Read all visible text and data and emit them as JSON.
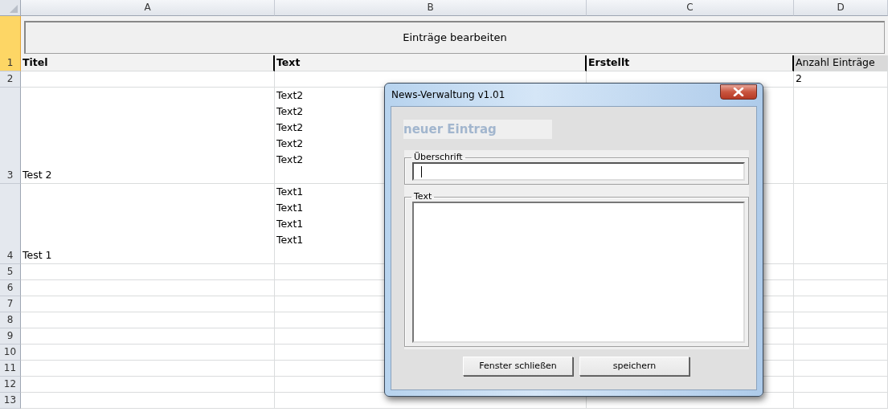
{
  "sheet": {
    "columns": [
      {
        "label": "A"
      },
      {
        "label": "B"
      },
      {
        "label": "C"
      },
      {
        "label": "D"
      }
    ],
    "sheet_button": "Einträge bearbeiten",
    "rows": [
      {
        "number": "1",
        "selected": true,
        "cells": [
          {
            "kind": "header",
            "lines": [
              "Titel"
            ]
          },
          {
            "kind": "header",
            "lines": [
              "Text"
            ]
          },
          {
            "kind": "header",
            "lines": [
              "Erstellt"
            ]
          },
          {
            "kind": "label",
            "lines": [
              "Anzahl Einträge"
            ]
          }
        ]
      },
      {
        "number": "2",
        "selected": false,
        "cells": [
          {
            "kind": "plain"
          },
          {
            "kind": "plain"
          },
          {
            "kind": "plain"
          },
          {
            "kind": "plain",
            "lines": [
              "2"
            ]
          }
        ]
      },
      {
        "number": "3",
        "selected": false,
        "cells": [
          {
            "kind": "plain",
            "lines": [
              "Test 2"
            ]
          },
          {
            "kind": "plain",
            "lines": [
              "Text2",
              "Text2",
              "Text2",
              "Text2",
              "Text2"
            ]
          },
          {
            "kind": "plain"
          },
          {
            "kind": "plain"
          }
        ]
      },
      {
        "number": "4",
        "selected": false,
        "cells": [
          {
            "kind": "plain",
            "lines": [
              "Test 1"
            ]
          },
          {
            "kind": "plain",
            "lines": [
              "Text1",
              "Text1",
              "Text1",
              "Text1"
            ]
          },
          {
            "kind": "plain"
          },
          {
            "kind": "plain"
          }
        ]
      },
      {
        "number": "5",
        "selected": false
      },
      {
        "number": "6",
        "selected": false
      },
      {
        "number": "7",
        "selected": false
      },
      {
        "number": "8",
        "selected": false
      },
      {
        "number": "9",
        "selected": false
      },
      {
        "number": "10",
        "selected": false
      },
      {
        "number": "11",
        "selected": false
      },
      {
        "number": "12",
        "selected": false
      },
      {
        "number": "13",
        "selected": false
      }
    ]
  },
  "dialog": {
    "title": "News-Verwaltung v1.01",
    "heading": "neuer Eintrag",
    "fields": [
      {
        "kind": "line",
        "legend": "Überschrift",
        "focused": true
      },
      {
        "kind": "area",
        "legend": "Text",
        "focused": false
      }
    ],
    "buttons": [
      "Fenster schließen",
      "speichern"
    ]
  }
}
